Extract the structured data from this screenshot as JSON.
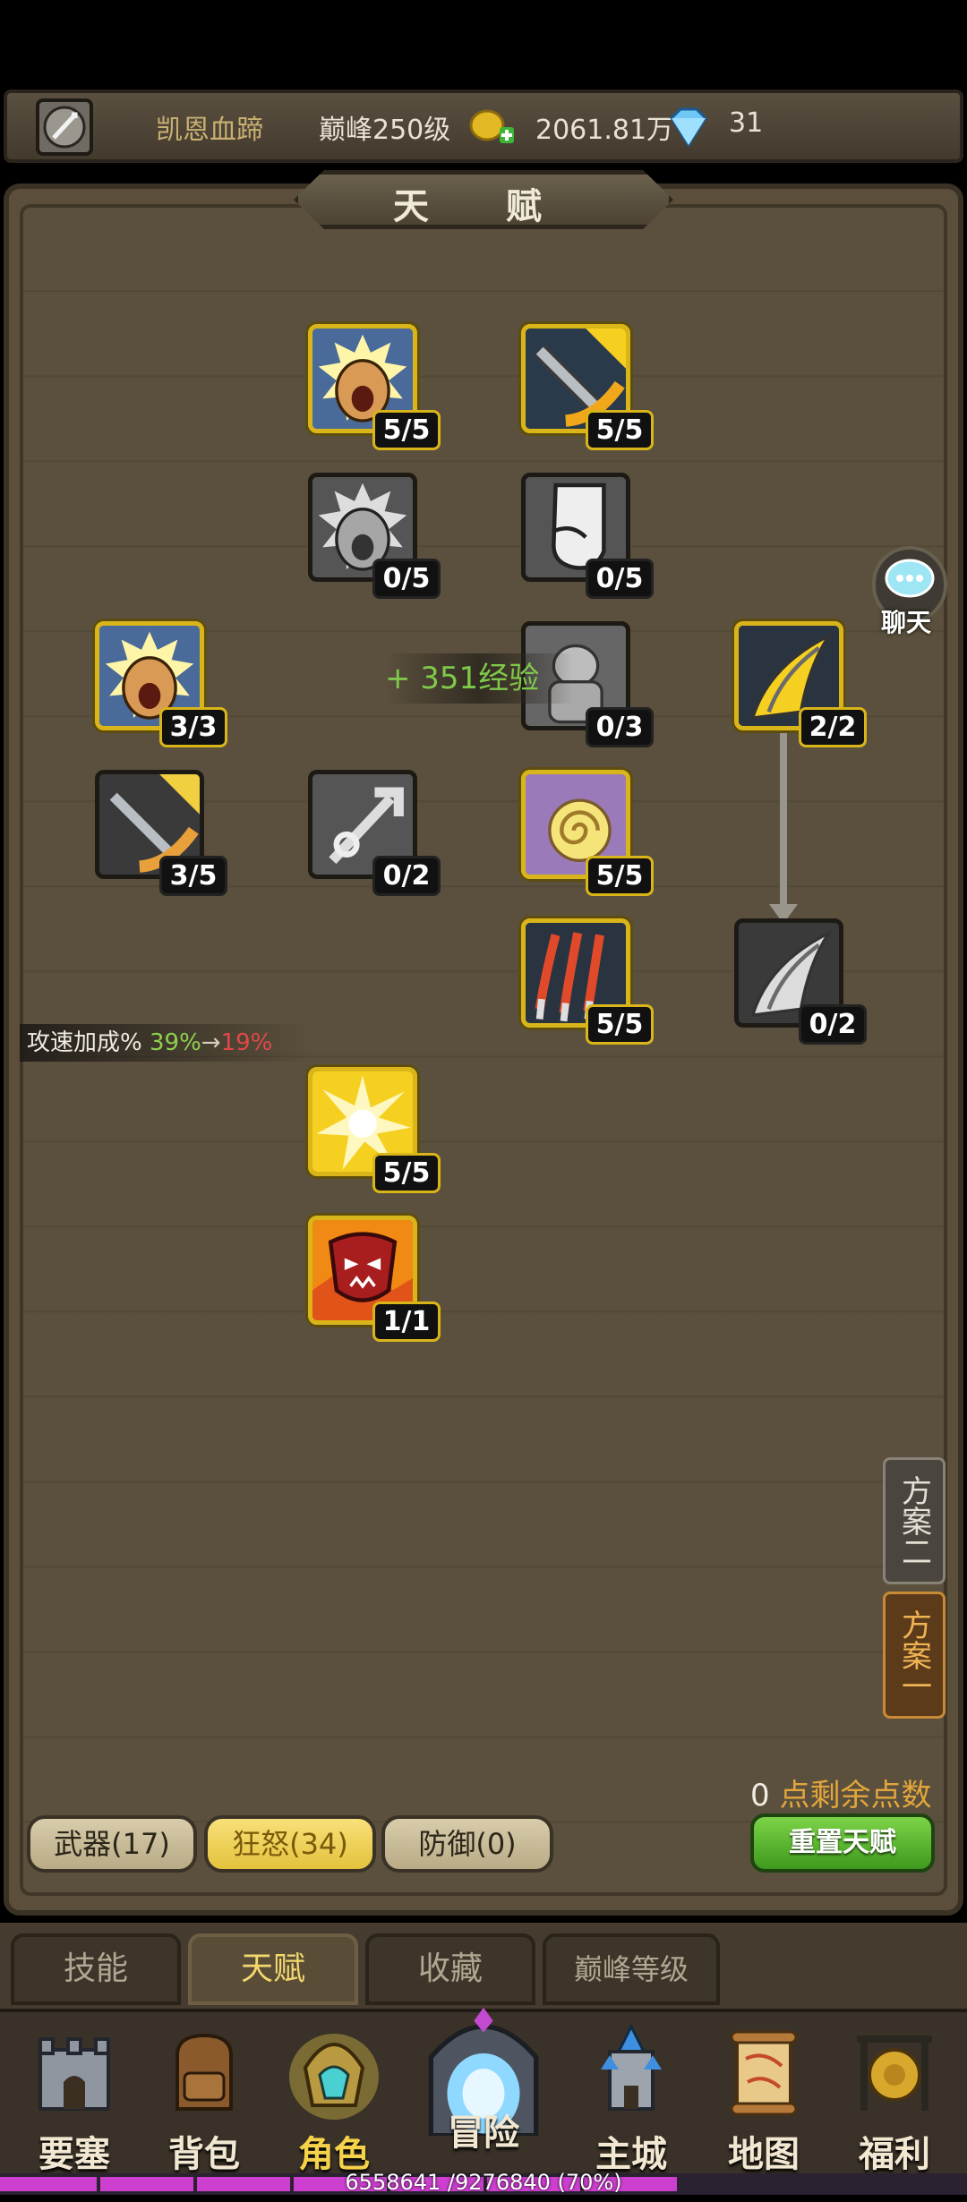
{
  "topbar": {
    "player_name": "凯恩血蹄",
    "peak_level": "巅峰250级",
    "gold": "2061.81万",
    "diamonds": "31"
  },
  "panel": {
    "title": "天  赋"
  },
  "talents": [
    {
      "name": "roar-talent",
      "level": "5/5"
    },
    {
      "name": "sword-strike-talent",
      "level": "5/5"
    },
    {
      "name": "roar-locked-talent",
      "level": "0/5"
    },
    {
      "name": "fist-talent",
      "level": "0/5"
    },
    {
      "name": "roar-left-talent",
      "level": "3/3"
    },
    {
      "name": "stone-golem-talent",
      "level": "0/3"
    },
    {
      "name": "slash-wave-talent",
      "level": "2/2"
    },
    {
      "name": "sword-spin-talent",
      "level": "3/5"
    },
    {
      "name": "chain-talent",
      "level": "0/2"
    },
    {
      "name": "whirlwind-talent",
      "level": "5/5"
    },
    {
      "name": "claw-talent",
      "level": "5/5"
    },
    {
      "name": "slash-wave-locked-talent",
      "level": "0/2"
    },
    {
      "name": "burst-talent",
      "level": "5/5"
    },
    {
      "name": "rage-mask-talent",
      "level": "1/1"
    }
  ],
  "exp_popup": "+ 351经验",
  "tooltip": {
    "label": "攻速加成% ",
    "current": "39%",
    "arrow": "→",
    "next": "19%"
  },
  "chat": {
    "label": "聊天"
  },
  "plans": {
    "plan2": "方案二",
    "plan1": "方案一"
  },
  "points": {
    "value": "0",
    "label": " 点剩余点数"
  },
  "categories": {
    "weapon": "武器(17)",
    "rage": "狂怒(34)",
    "defense": "防御(0)"
  },
  "reset_button": "重置天赋",
  "tabs": {
    "skills": "技能",
    "talent": "天赋",
    "collection": "收藏",
    "peak": "巅峰等级"
  },
  "nav": {
    "fortress": "要塞",
    "backpack": "背包",
    "character": "角色",
    "adventure": "冒险",
    "main_city": "主城",
    "map": "地图",
    "welfare": "福利"
  },
  "experience": {
    "text": "6558641 /9276840 (70%)",
    "progress": 0.7
  },
  "colors": {
    "active_gold": "#d9b51a",
    "exp_green": "#7fc94a",
    "exp_bar": "#cc3fcf"
  }
}
